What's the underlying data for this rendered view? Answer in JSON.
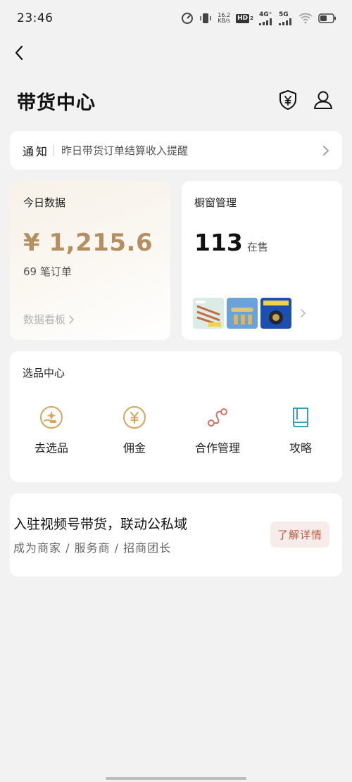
{
  "status_bar": {
    "time": "23:46",
    "net_speed_value": "16.2",
    "net_speed_unit": "KB/s",
    "hd": "HD",
    "hd_sub": "2",
    "network_4g": "4G⁺",
    "network_4g_sub": "1",
    "network_5g": "5G",
    "icons": [
      "speedometer-icon",
      "vibrate-icon",
      "signal-icon",
      "wifi-icon",
      "battery-icon"
    ]
  },
  "header": {
    "title": "带货中心",
    "icons": [
      "back-chevron-icon",
      "shield-yuan-icon",
      "user-icon"
    ]
  },
  "notice": {
    "label": "通知",
    "text": "昨日带货订单结算收入提醒"
  },
  "today": {
    "title": "今日数据",
    "amount": "¥ 1,215.6",
    "orders": "69 笔订单",
    "dashboard_link": "数据看板",
    "accent_color": "#b48f62"
  },
  "window": {
    "title": "橱窗管理",
    "count": "113",
    "count_unit": "在售"
  },
  "select_center": {
    "title": "选品中心",
    "items": [
      {
        "label": "去选品",
        "icon": "hand-sparkle-icon"
      },
      {
        "label": "佣金",
        "icon": "yuan-coin-icon"
      },
      {
        "label": "合作管理",
        "icon": "connection-icon"
      },
      {
        "label": "攻略",
        "icon": "book-icon"
      }
    ],
    "icon_colors": {
      "gold": "#d9a455",
      "red": "#d7735f",
      "teal": "#3d9bbf"
    }
  },
  "join": {
    "title": "入驻视频号带货，联动公私域",
    "subtitle": "成为商家 / 服务商 / 招商团长",
    "button": "了解详情",
    "button_color": "#c75b47"
  }
}
